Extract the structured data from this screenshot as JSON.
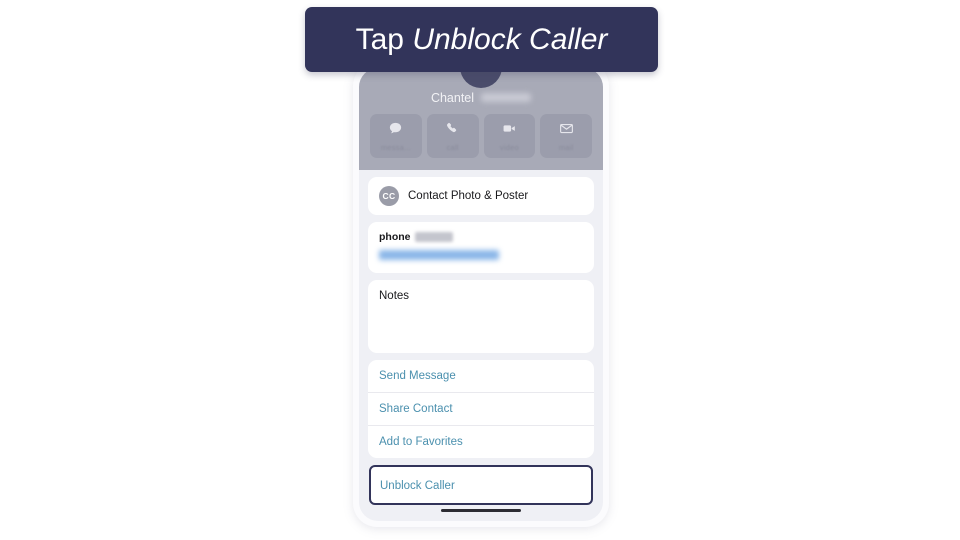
{
  "banner": {
    "prefix": "Tap ",
    "emphasis": "Unblock Caller",
    "background_color": "#32345a",
    "text_color": "#ffffff"
  },
  "phone": {
    "contact": {
      "avatar_initials": "",
      "first_name": "Chantel",
      "last_name_redacted": true
    },
    "quick_actions": [
      {
        "label": "messa...",
        "icon": "message-bubble-icon"
      },
      {
        "label": "call",
        "icon": "phone-handset-icon"
      },
      {
        "label": "video",
        "icon": "video-camera-icon"
      },
      {
        "label": "mail",
        "icon": "envelope-icon"
      }
    ],
    "photo_poster": {
      "badge_initials": "CC",
      "label": "Contact Photo & Poster"
    },
    "phone_field": {
      "label": "phone",
      "badge_redacted": true,
      "number_redacted": true
    },
    "notes": {
      "label": "Notes",
      "value": ""
    },
    "action_links": [
      {
        "label": "Send Message"
      },
      {
        "label": "Share Contact"
      },
      {
        "label": "Add to Favorites"
      }
    ],
    "highlighted_action": {
      "label": "Unblock Caller",
      "highlight_color": "#32345a"
    },
    "link_color": "#4b90ae",
    "screen_background": "#eff0f5"
  }
}
